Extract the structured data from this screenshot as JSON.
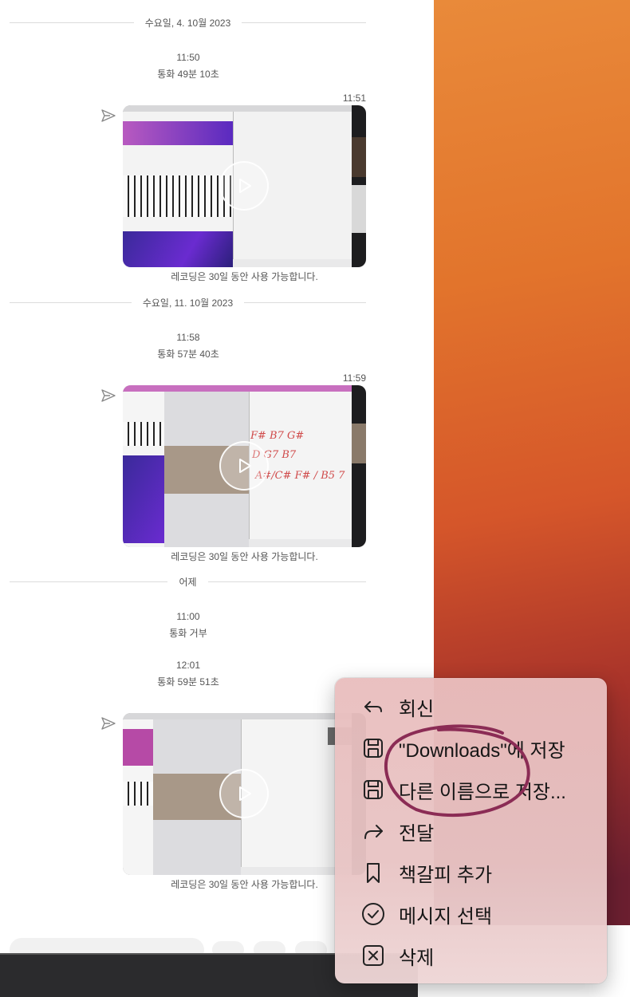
{
  "top_cut_text": "",
  "sections": [
    {
      "date": "수요일, 4. 10월 2023",
      "call_time": "11:50",
      "call_desc": "통화 49분 10초",
      "video_time": "11:51",
      "caption": "레코딩은 30일 동안 사용 가능합니다."
    },
    {
      "date": "수요일, 11. 10월 2023",
      "call_time": "11:58",
      "call_desc": "통화 57분 40초",
      "video_time": "11:59",
      "caption": "레코딩은 30일 동안 사용 가능합니다."
    },
    {
      "date": "어제",
      "call_time": "11:00",
      "call_desc": "통화 거부",
      "call_time2": "12:01",
      "call_desc2": "통화 59분 51초",
      "caption": "레코딩은 30일 동안 사용 가능합니다."
    }
  ],
  "video2_notes": [
    "F# B7 G#",
    "D G7 B7",
    "A#/C# F# / B5 7"
  ],
  "context_menu": {
    "items": [
      {
        "label": "회신",
        "icon": "reply-icon"
      },
      {
        "label": "\"Downloads\"에 저장",
        "icon": "save-disk-icon"
      },
      {
        "label": "다른 이름으로 저장...",
        "icon": "save-as-disk-icon"
      },
      {
        "label": "전달",
        "icon": "forward-icon"
      },
      {
        "label": "책갈피 추가",
        "icon": "bookmark-icon"
      },
      {
        "label": "메시지 선택",
        "icon": "check-circle-icon"
      },
      {
        "label": "삭제",
        "icon": "delete-box-icon"
      }
    ]
  },
  "colors": {
    "annotation": "#8b2c55",
    "wallpaper_top": "#e98a3a",
    "wallpaper_bottom": "#6b1f30"
  }
}
